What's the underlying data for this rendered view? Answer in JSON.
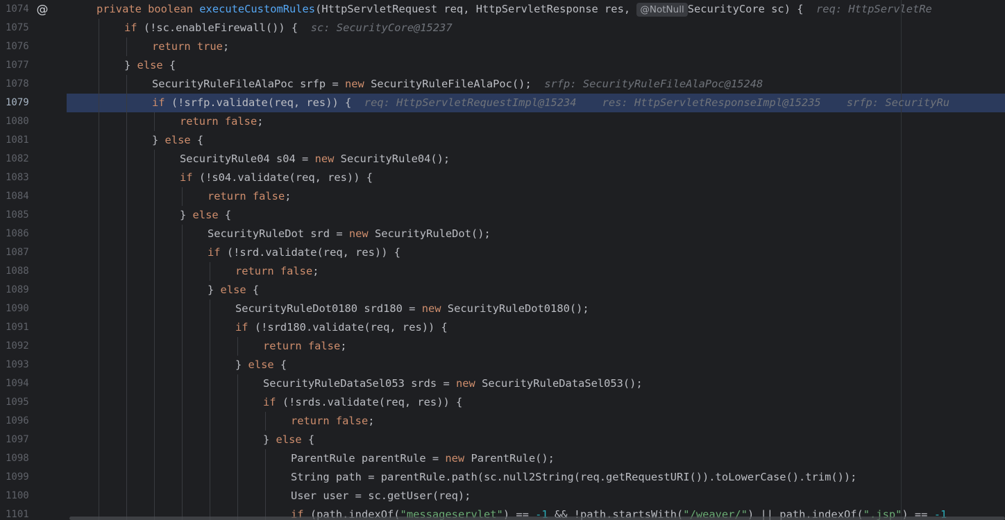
{
  "editor": {
    "gutter_icon": "at-sign-override-icon",
    "active_line": "1079",
    "lines": [
      {
        "num": "1074",
        "tokens": [
          [
            "kw",
            "private "
          ],
          [
            "kw",
            "boolean "
          ],
          [
            "fn",
            "executeCustomRules"
          ],
          [
            "tx",
            "(HttpServletRequest req, HttpServletResponse res, "
          ],
          [
            "ann",
            "@NotNull"
          ],
          [
            "tx",
            "SecurityCore sc) {  "
          ],
          [
            "hint",
            "req: HttpServletRe"
          ]
        ]
      },
      {
        "num": "1075",
        "tokens": [
          [
            "kw",
            "if "
          ],
          [
            "tx",
            "(!sc.enableFirewall()) {  "
          ],
          [
            "hint",
            "sc: SecurityCore@15237"
          ]
        ]
      },
      {
        "num": "1076",
        "tokens": [
          [
            "kw",
            "return "
          ],
          [
            "kw",
            "true"
          ],
          [
            "tx",
            ";"
          ]
        ]
      },
      {
        "num": "1077",
        "tokens": [
          [
            "tx",
            "} "
          ],
          [
            "kw",
            "else "
          ],
          [
            "tx",
            "{"
          ]
        ]
      },
      {
        "num": "1078",
        "tokens": [
          [
            "tx",
            "SecurityRuleFileAlaPoc srfp = "
          ],
          [
            "kw",
            "new "
          ],
          [
            "tx",
            "SecurityRuleFileAlaPoc();  "
          ],
          [
            "hint",
            "srfp: SecurityRuleFileAlaPoc@15248"
          ]
        ]
      },
      {
        "num": "1079",
        "tokens": [
          [
            "kw",
            "if "
          ],
          [
            "tx",
            "(!srfp.validate(req, res)) {  "
          ],
          [
            "hint",
            "req: HttpServletRequestImpl@15234    res: HttpServletResponseImpl@15235    srfp: SecurityRu"
          ]
        ]
      },
      {
        "num": "1080",
        "tokens": [
          [
            "kw",
            "return "
          ],
          [
            "kw",
            "false"
          ],
          [
            "tx",
            ";"
          ]
        ]
      },
      {
        "num": "1081",
        "tokens": [
          [
            "tx",
            "} "
          ],
          [
            "kw",
            "else "
          ],
          [
            "tx",
            "{"
          ]
        ]
      },
      {
        "num": "1082",
        "tokens": [
          [
            "tx",
            "SecurityRule04 s04 = "
          ],
          [
            "kw",
            "new "
          ],
          [
            "tx",
            "SecurityRule04();"
          ]
        ]
      },
      {
        "num": "1083",
        "tokens": [
          [
            "kw",
            "if "
          ],
          [
            "tx",
            "(!s04.validate(req, res)) {"
          ]
        ]
      },
      {
        "num": "1084",
        "tokens": [
          [
            "kw",
            "return "
          ],
          [
            "kw",
            "false"
          ],
          [
            "tx",
            ";"
          ]
        ]
      },
      {
        "num": "1085",
        "tokens": [
          [
            "tx",
            "} "
          ],
          [
            "kw",
            "else "
          ],
          [
            "tx",
            "{"
          ]
        ]
      },
      {
        "num": "1086",
        "tokens": [
          [
            "tx",
            "SecurityRuleDot srd = "
          ],
          [
            "kw",
            "new "
          ],
          [
            "tx",
            "SecurityRuleDot();"
          ]
        ]
      },
      {
        "num": "1087",
        "tokens": [
          [
            "kw",
            "if "
          ],
          [
            "tx",
            "(!srd.validate(req, res)) {"
          ]
        ]
      },
      {
        "num": "1088",
        "tokens": [
          [
            "kw",
            "return "
          ],
          [
            "kw",
            "false"
          ],
          [
            "tx",
            ";"
          ]
        ]
      },
      {
        "num": "1089",
        "tokens": [
          [
            "tx",
            "} "
          ],
          [
            "kw",
            "else "
          ],
          [
            "tx",
            "{"
          ]
        ]
      },
      {
        "num": "1090",
        "tokens": [
          [
            "tx",
            "SecurityRuleDot0180 srd180 = "
          ],
          [
            "kw",
            "new "
          ],
          [
            "tx",
            "SecurityRuleDot0180();"
          ]
        ]
      },
      {
        "num": "1091",
        "tokens": [
          [
            "kw",
            "if "
          ],
          [
            "tx",
            "(!srd180.validate(req, res)) {"
          ]
        ]
      },
      {
        "num": "1092",
        "tokens": [
          [
            "kw",
            "return "
          ],
          [
            "kw",
            "false"
          ],
          [
            "tx",
            ";"
          ]
        ]
      },
      {
        "num": "1093",
        "tokens": [
          [
            "tx",
            "} "
          ],
          [
            "kw",
            "else "
          ],
          [
            "tx",
            "{"
          ]
        ]
      },
      {
        "num": "1094",
        "tokens": [
          [
            "tx",
            "SecurityRuleDataSel053 srds = "
          ],
          [
            "kw",
            "new "
          ],
          [
            "tx",
            "SecurityRuleDataSel053();"
          ]
        ]
      },
      {
        "num": "1095",
        "tokens": [
          [
            "kw",
            "if "
          ],
          [
            "tx",
            "(!srds.validate(req, res)) {"
          ]
        ]
      },
      {
        "num": "1096",
        "tokens": [
          [
            "kw",
            "return "
          ],
          [
            "kw",
            "false"
          ],
          [
            "tx",
            ";"
          ]
        ]
      },
      {
        "num": "1097",
        "tokens": [
          [
            "tx",
            "} "
          ],
          [
            "kw",
            "else "
          ],
          [
            "tx",
            "{"
          ]
        ]
      },
      {
        "num": "1098",
        "tokens": [
          [
            "tx",
            "ParentRule parentRule = "
          ],
          [
            "kw",
            "new "
          ],
          [
            "tx",
            "ParentRule();"
          ]
        ]
      },
      {
        "num": "1099",
        "tokens": [
          [
            "tx",
            "String path = parentRule.path(sc.null2String(req.getRequestURI()).toLowerCase().trim());"
          ]
        ]
      },
      {
        "num": "1100",
        "tokens": [
          [
            "tx",
            "User user = sc.getUser(req);"
          ]
        ]
      },
      {
        "num": "1101",
        "tokens": [
          [
            "kw",
            "if "
          ],
          [
            "tx",
            "(path.indexOf("
          ],
          [
            "str",
            "\"messageservlet\""
          ],
          [
            "tx",
            ") == "
          ],
          [
            "num",
            "-1"
          ],
          [
            "tx",
            " && !path.startsWith("
          ],
          [
            "str",
            "\"/weaver/\""
          ],
          [
            "tx",
            ") || path.indexOf("
          ],
          [
            "str",
            "\".jsp\""
          ],
          [
            "tx",
            ") == "
          ],
          [
            "num",
            "-1"
          ]
        ]
      }
    ]
  }
}
